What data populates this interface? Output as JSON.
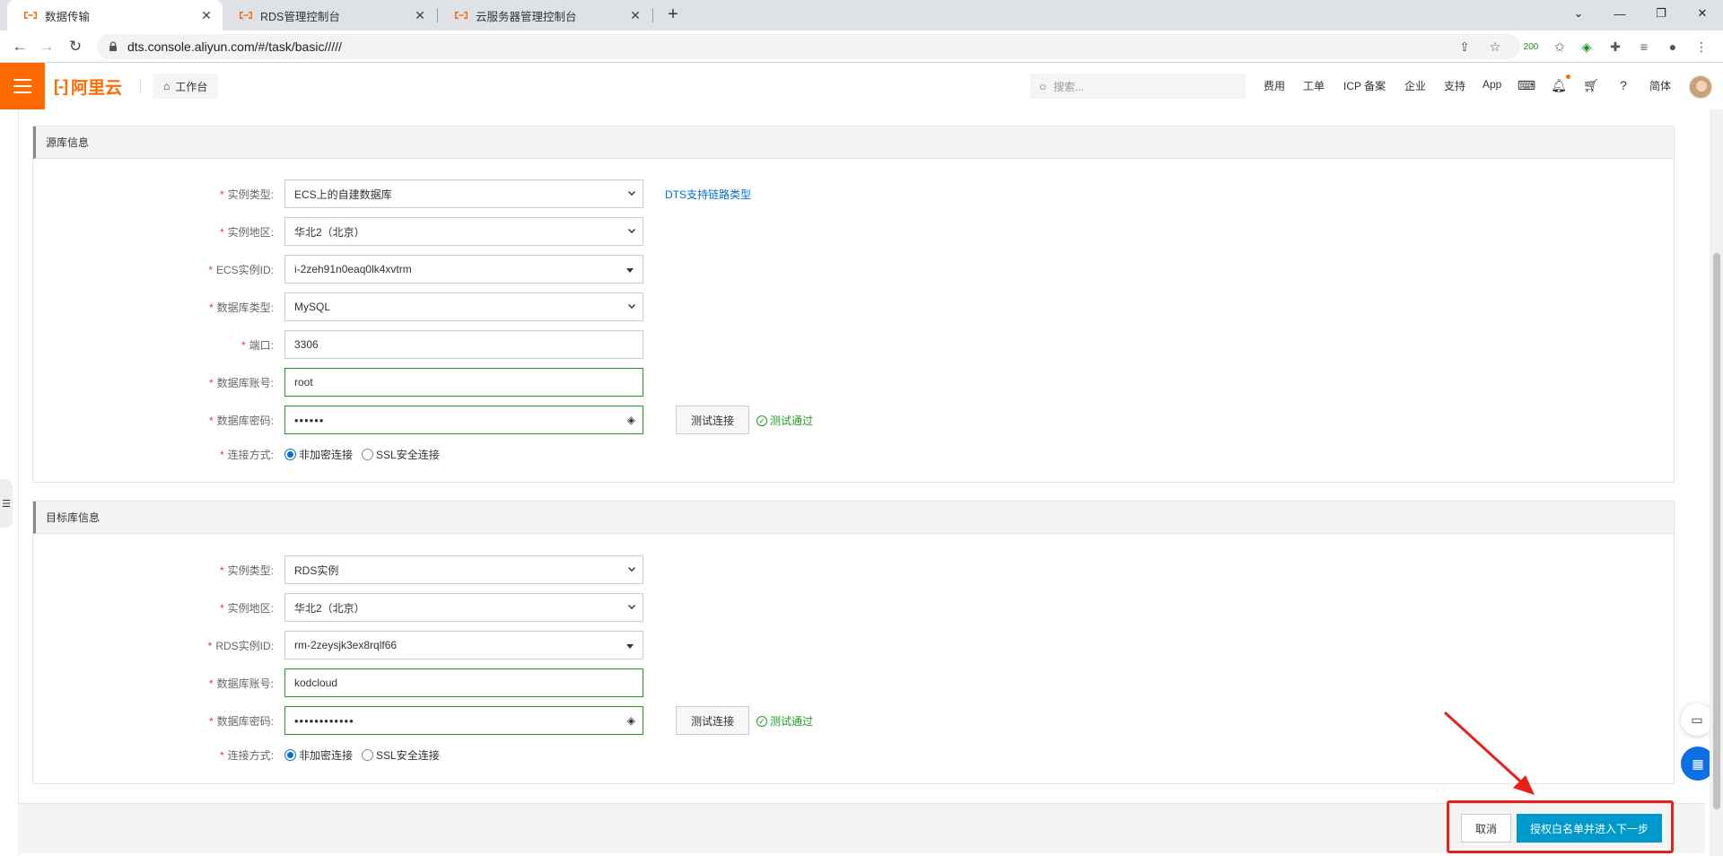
{
  "browser": {
    "tabs": [
      {
        "label": "数据传输",
        "active": true
      },
      {
        "label": "RDS管理控制台",
        "active": false
      },
      {
        "label": "云服务器管理控制台",
        "active": false
      }
    ],
    "url": "dts.console.aliyun.com/#/task/basic/////",
    "extension_badge": "200",
    "brand_color": "#ff6a00"
  },
  "header": {
    "logo_text": "阿里云",
    "workbench_label": "工作台",
    "search_placeholder": "搜索...",
    "links": [
      "费用",
      "工单",
      "ICP 备案",
      "企业",
      "支持",
      "App"
    ],
    "language": "简体"
  },
  "source": {
    "title": "源库信息",
    "instance_type_label": "实例类型:",
    "instance_type_value": "ECS上的自建数据库",
    "link_label": "DTS支持链路类型",
    "region_label": "实例地区:",
    "region_value": "华北2（北京）",
    "ecs_id_label": "ECS实例ID:",
    "ecs_id_value": "i-2zeh91n0eaq0lk4xvtrm",
    "db_type_label": "数据库类型:",
    "db_type_value": "MySQL",
    "port_label": "端口:",
    "port_value": "3306",
    "account_label": "数据库账号:",
    "account_value": "root",
    "password_label": "数据库密码:",
    "password_value": "••••••",
    "test_button": "测试连接",
    "test_result": "测试通过",
    "conn_label": "连接方式:",
    "conn_option1": "非加密连接",
    "conn_option2": "SSL安全连接"
  },
  "target": {
    "title": "目标库信息",
    "instance_type_label": "实例类型:",
    "instance_type_value": "RDS实例",
    "region_label": "实例地区:",
    "region_value": "华北2（北京）",
    "rds_id_label": "RDS实例ID:",
    "rds_id_value": "rm-2zeysjk3ex8rqlf66",
    "account_label": "数据库账号:",
    "account_value": "kodcloud",
    "password_label": "数据库密码:",
    "password_value": "••••••••••••",
    "test_button": "测试连接",
    "test_result": "测试通过",
    "conn_label": "连接方式:",
    "conn_option1": "非加密连接",
    "conn_option2": "SSL安全连接"
  },
  "footer": {
    "cancel_label": "取消",
    "next_label": "授权白名单并进入下一步"
  }
}
